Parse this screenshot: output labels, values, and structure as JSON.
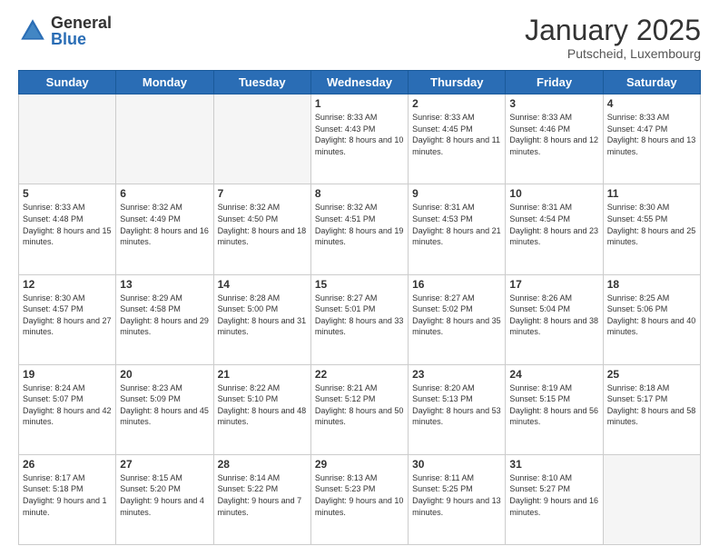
{
  "logo": {
    "general": "General",
    "blue": "Blue"
  },
  "title": "January 2025",
  "location": "Putscheid, Luxembourg",
  "days_of_week": [
    "Sunday",
    "Monday",
    "Tuesday",
    "Wednesday",
    "Thursday",
    "Friday",
    "Saturday"
  ],
  "weeks": [
    [
      {
        "day": "",
        "info": ""
      },
      {
        "day": "",
        "info": ""
      },
      {
        "day": "",
        "info": ""
      },
      {
        "day": "1",
        "info": "Sunrise: 8:33 AM\nSunset: 4:43 PM\nDaylight: 8 hours\nand 10 minutes."
      },
      {
        "day": "2",
        "info": "Sunrise: 8:33 AM\nSunset: 4:45 PM\nDaylight: 8 hours\nand 11 minutes."
      },
      {
        "day": "3",
        "info": "Sunrise: 8:33 AM\nSunset: 4:46 PM\nDaylight: 8 hours\nand 12 minutes."
      },
      {
        "day": "4",
        "info": "Sunrise: 8:33 AM\nSunset: 4:47 PM\nDaylight: 8 hours\nand 13 minutes."
      }
    ],
    [
      {
        "day": "5",
        "info": "Sunrise: 8:33 AM\nSunset: 4:48 PM\nDaylight: 8 hours\nand 15 minutes."
      },
      {
        "day": "6",
        "info": "Sunrise: 8:32 AM\nSunset: 4:49 PM\nDaylight: 8 hours\nand 16 minutes."
      },
      {
        "day": "7",
        "info": "Sunrise: 8:32 AM\nSunset: 4:50 PM\nDaylight: 8 hours\nand 18 minutes."
      },
      {
        "day": "8",
        "info": "Sunrise: 8:32 AM\nSunset: 4:51 PM\nDaylight: 8 hours\nand 19 minutes."
      },
      {
        "day": "9",
        "info": "Sunrise: 8:31 AM\nSunset: 4:53 PM\nDaylight: 8 hours\nand 21 minutes."
      },
      {
        "day": "10",
        "info": "Sunrise: 8:31 AM\nSunset: 4:54 PM\nDaylight: 8 hours\nand 23 minutes."
      },
      {
        "day": "11",
        "info": "Sunrise: 8:30 AM\nSunset: 4:55 PM\nDaylight: 8 hours\nand 25 minutes."
      }
    ],
    [
      {
        "day": "12",
        "info": "Sunrise: 8:30 AM\nSunset: 4:57 PM\nDaylight: 8 hours\nand 27 minutes."
      },
      {
        "day": "13",
        "info": "Sunrise: 8:29 AM\nSunset: 4:58 PM\nDaylight: 8 hours\nand 29 minutes."
      },
      {
        "day": "14",
        "info": "Sunrise: 8:28 AM\nSunset: 5:00 PM\nDaylight: 8 hours\nand 31 minutes."
      },
      {
        "day": "15",
        "info": "Sunrise: 8:27 AM\nSunset: 5:01 PM\nDaylight: 8 hours\nand 33 minutes."
      },
      {
        "day": "16",
        "info": "Sunrise: 8:27 AM\nSunset: 5:02 PM\nDaylight: 8 hours\nand 35 minutes."
      },
      {
        "day": "17",
        "info": "Sunrise: 8:26 AM\nSunset: 5:04 PM\nDaylight: 8 hours\nand 38 minutes."
      },
      {
        "day": "18",
        "info": "Sunrise: 8:25 AM\nSunset: 5:06 PM\nDaylight: 8 hours\nand 40 minutes."
      }
    ],
    [
      {
        "day": "19",
        "info": "Sunrise: 8:24 AM\nSunset: 5:07 PM\nDaylight: 8 hours\nand 42 minutes."
      },
      {
        "day": "20",
        "info": "Sunrise: 8:23 AM\nSunset: 5:09 PM\nDaylight: 8 hours\nand 45 minutes."
      },
      {
        "day": "21",
        "info": "Sunrise: 8:22 AM\nSunset: 5:10 PM\nDaylight: 8 hours\nand 48 minutes."
      },
      {
        "day": "22",
        "info": "Sunrise: 8:21 AM\nSunset: 5:12 PM\nDaylight: 8 hours\nand 50 minutes."
      },
      {
        "day": "23",
        "info": "Sunrise: 8:20 AM\nSunset: 5:13 PM\nDaylight: 8 hours\nand 53 minutes."
      },
      {
        "day": "24",
        "info": "Sunrise: 8:19 AM\nSunset: 5:15 PM\nDaylight: 8 hours\nand 56 minutes."
      },
      {
        "day": "25",
        "info": "Sunrise: 8:18 AM\nSunset: 5:17 PM\nDaylight: 8 hours\nand 58 minutes."
      }
    ],
    [
      {
        "day": "26",
        "info": "Sunrise: 8:17 AM\nSunset: 5:18 PM\nDaylight: 9 hours\nand 1 minute."
      },
      {
        "day": "27",
        "info": "Sunrise: 8:15 AM\nSunset: 5:20 PM\nDaylight: 9 hours\nand 4 minutes."
      },
      {
        "day": "28",
        "info": "Sunrise: 8:14 AM\nSunset: 5:22 PM\nDaylight: 9 hours\nand 7 minutes."
      },
      {
        "day": "29",
        "info": "Sunrise: 8:13 AM\nSunset: 5:23 PM\nDaylight: 9 hours\nand 10 minutes."
      },
      {
        "day": "30",
        "info": "Sunrise: 8:11 AM\nSunset: 5:25 PM\nDaylight: 9 hours\nand 13 minutes."
      },
      {
        "day": "31",
        "info": "Sunrise: 8:10 AM\nSunset: 5:27 PM\nDaylight: 9 hours\nand 16 minutes."
      },
      {
        "day": "",
        "info": ""
      }
    ]
  ]
}
